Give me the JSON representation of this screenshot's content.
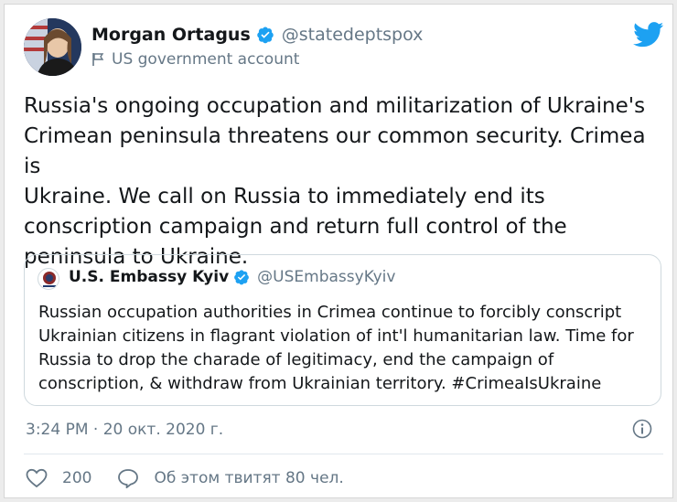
{
  "author": {
    "name": "Morgan Ortagus",
    "handle": "@statedeptspox",
    "label": "US government account"
  },
  "tweet": {
    "text": "Russia's ongoing occupation and militarization of Ukraine's\nCrimean peninsula threatens our common security. Crimea is\nUkraine. We call on Russia to immediately end its\nconscription campaign and return full control of the\npeninsula to Ukraine."
  },
  "quoted": {
    "name": "U.S. Embassy Kyiv",
    "handle": "@USEmbassyKyiv",
    "avatar_caption": "Ukraine",
    "text": "Russian occupation authorities in Crimea continue to forcibly conscript\nUkrainian citizens in flagrant violation of int'l humanitarian law. Time for\nRussia to drop the charade of legitimacy, end the campaign of\nconscription, & withdraw from Ukrainian territory. #CrimeaIsUkraine"
  },
  "meta": {
    "timestamp": "3:24 PM · 20 окт. 2020 г."
  },
  "actions": {
    "likes": "200",
    "talking": "Об этом твитят 80 чел."
  },
  "colors": {
    "twitter_blue": "#1da1f2",
    "text": "#14171a",
    "muted": "#657786"
  },
  "icons": [
    "verified-badge-icon",
    "government-flag-icon",
    "twitter-bird-icon",
    "info-icon",
    "heart-icon",
    "reply-bubble-icon"
  ]
}
